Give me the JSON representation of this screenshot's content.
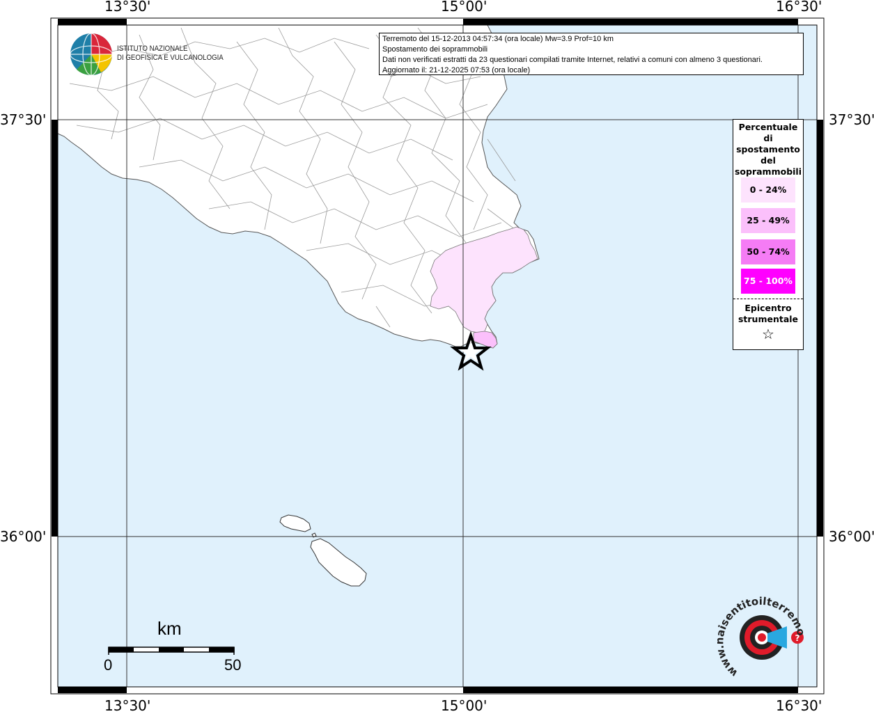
{
  "map": {
    "frame": {
      "top_ticks": [
        "13°30'",
        "15°00'",
        "16°30'"
      ],
      "bottom_ticks": [
        "13°30'",
        "15°00'",
        "16°30'"
      ],
      "left_ticks": [
        "37°30'",
        "36°00'"
      ],
      "right_ticks": [
        "37°30'",
        "36°00'"
      ]
    },
    "colors": {
      "sea": "#e0f1fc",
      "land": "#ffffff",
      "class_0_24": "#fde3fd",
      "class_25_49": "#fbc0fb",
      "class_50_74": "#f57cf5",
      "class_75_100": "#ff00ff"
    },
    "logo": {
      "name": "ingv-globe-logo",
      "line1": "ISTITUTO NAZIONALE",
      "line2": "DI GEOFISICA E VULCANOLOGIA"
    },
    "info_box": {
      "line1": "Terremoto del 15-12-2013 04:57:34 (ora locale) Mw=3.9 Prof=10 km",
      "line2": "Spostamento dei soprammobili",
      "line3": "Dati non verificati estratti da 23 questionari compilati tramite Internet, relativi a comuni con almeno 3 questionari.",
      "line4": "Aggiornato il: 21-12-2025 07:53 (ora locale)"
    },
    "legend": {
      "title_lines": [
        "Percentuale",
        "di",
        "spostamento",
        "del",
        "soprammobili"
      ],
      "classes": [
        "0 - 24%",
        "25 - 49%",
        "50 - 74%",
        "75 - 100%"
      ],
      "epicenter_lines": [
        "Epicentro",
        "strumentale"
      ],
      "epicenter_symbol": "☆"
    },
    "scale_bar": {
      "unit": "km",
      "start": "0",
      "end": "50"
    },
    "watermark": {
      "name": "haisentitoilterremoto-logo",
      "text": "www.haisentitoilterremoto.it"
    }
  }
}
